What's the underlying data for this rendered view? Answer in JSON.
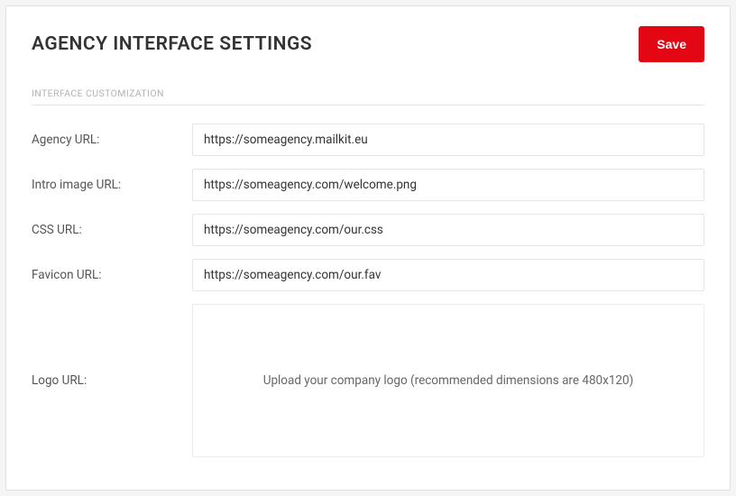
{
  "header": {
    "title": "AGENCY INTERFACE SETTINGS",
    "save_label": "Save"
  },
  "section": {
    "title": "INTERFACE CUSTOMIZATION"
  },
  "fields": {
    "agency_url": {
      "label": "Agency URL:",
      "value": "https://someagency.mailkit.eu"
    },
    "intro_image_url": {
      "label": "Intro image URL:",
      "value": "https://someagency.com/welcome.png"
    },
    "css_url": {
      "label": "CSS URL:",
      "value": "https://someagency.com/our.css"
    },
    "favicon_url": {
      "label": "Favicon URL:",
      "value": "https://someagency.com/our.fav"
    },
    "logo_url": {
      "label": "Logo URL:",
      "placeholder": "Upload your company logo (recommended dimensions are 480x120)"
    }
  }
}
